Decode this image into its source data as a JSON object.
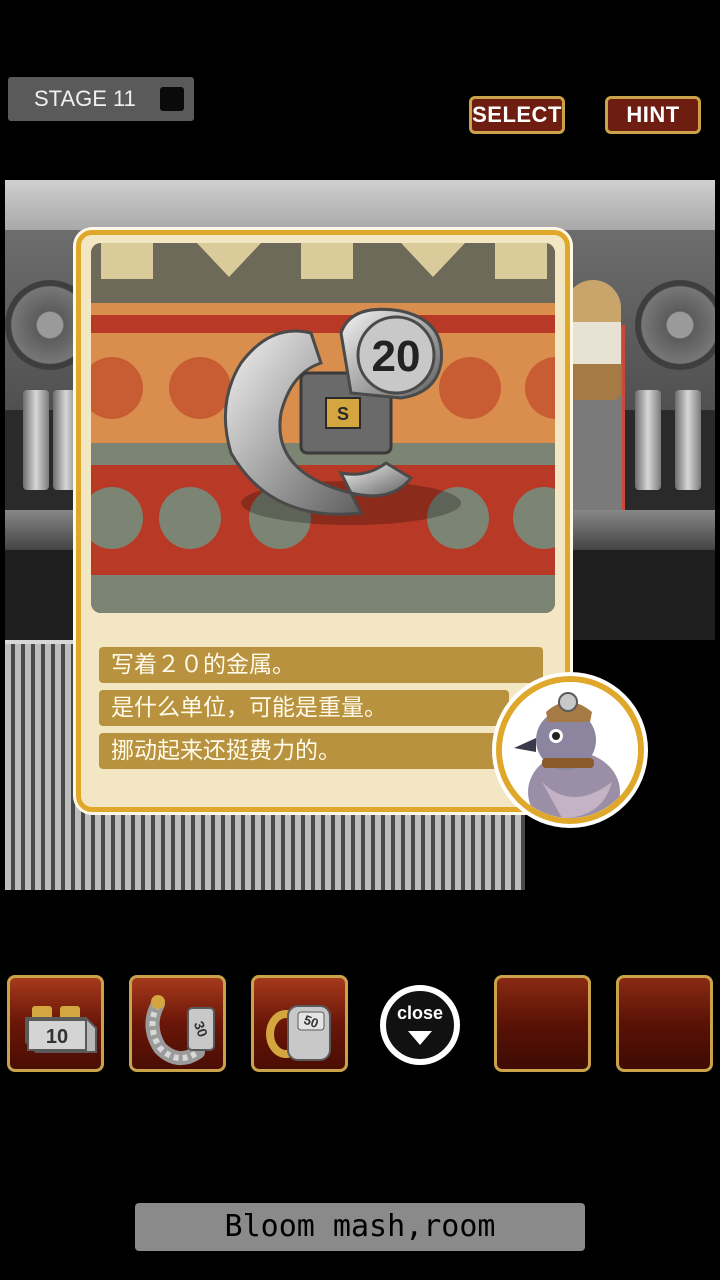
{
  "top_bar": {
    "stage_label": "STAGE 11",
    "select_label": "SELECT",
    "hint_label": "HINT"
  },
  "popup": {
    "item_icon": "weight-20-icon",
    "item_number": "20",
    "item_badge": "S",
    "lines": [
      "写着２０的金属。",
      "是什么单位，可能是重量。",
      "挪动起来还挺费力的。"
    ],
    "portrait_icon": "pigeon-portrait-icon"
  },
  "inventory": {
    "slots": [
      {
        "icon": "weight-10-icon",
        "number": "10"
      },
      {
        "icon": "weight-30-icon",
        "number": "30"
      },
      {
        "icon": "weight-50-icon",
        "number": "50"
      }
    ],
    "close_label": "close",
    "empty_slots": 2
  },
  "banner": {
    "text": "Bloom mash,room"
  },
  "colors": {
    "button_bg": "#6e1e10",
    "button_border": "#c9a24a",
    "card_border": "#e0a82a",
    "card_bg": "#f3e6c3",
    "text_band": "#b8923e"
  }
}
